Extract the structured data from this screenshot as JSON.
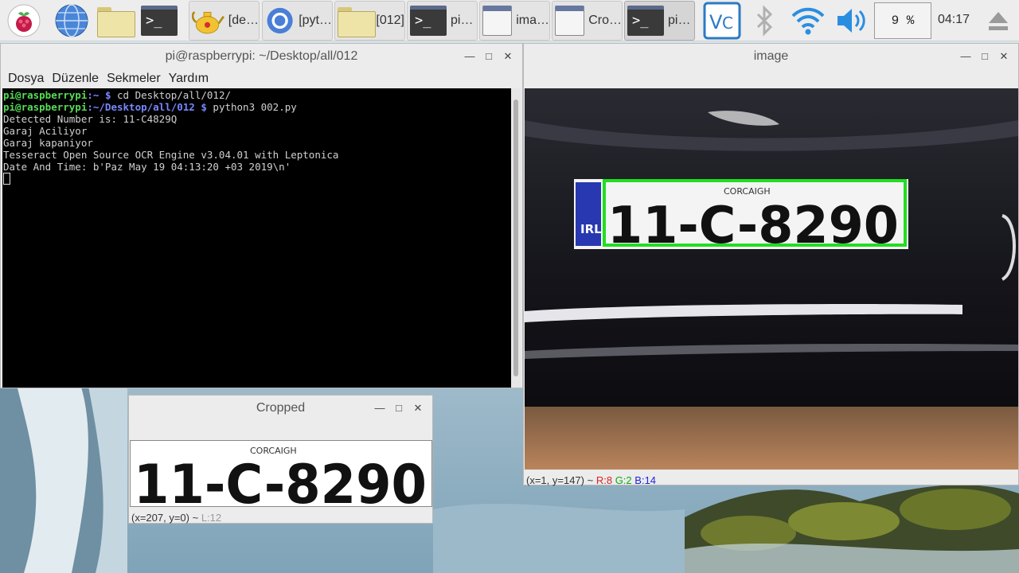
{
  "panel": {
    "tasks": [
      {
        "label": "[de…"
      },
      {
        "label": "[pyt…"
      },
      {
        "label": "[012]"
      },
      {
        "label": "pi…"
      },
      {
        "label": "ima…"
      },
      {
        "label": "Cro…"
      },
      {
        "label": "pi…"
      }
    ],
    "cpu_value": "9 %",
    "clock": "04:17"
  },
  "terminal": {
    "title": "pi@raspberrypi: ~/Desktop/all/012",
    "menu": [
      "Dosya",
      "Düzenle",
      "Sekmeler",
      "Yardım"
    ],
    "lines": [
      {
        "user": "pi@raspberrypi",
        "path": ":~",
        "sym": " $",
        "cmd": " cd Desktop/all/012/"
      },
      {
        "user": "pi@raspberrypi",
        "path": ":~/Desktop/all/012",
        "sym": " $",
        "cmd": " python3 002.py"
      }
    ],
    "output": [
      "Detected Number is: 11-C4829Q",
      "Garaj Aciliyor",
      "Garaj kapaniyor",
      "Tesseract Open Source OCR Engine v3.04.01 with Leptonica",
      "Date And Time: b'Paz May 19 04:13:20 +03 2019\\n'"
    ]
  },
  "image_window": {
    "title": "image",
    "plate_county": "CORCAIGH",
    "plate_number": "11-C-8290",
    "plate_badge": "IRL",
    "status_coords": "(x=1, y=147) ~",
    "status_r": "R:8",
    "status_g": "G:2",
    "status_b": "B:14"
  },
  "cropped_window": {
    "title": "Cropped",
    "plate_county": "CORCAIGH",
    "plate_number": "11-C-8290",
    "status": "(x=207, y=0) ~",
    "status_l": "L:12"
  },
  "colors": {
    "panel_bg": "#ededed",
    "terminal_bg": "#000000",
    "prompt_user": "#55dd55",
    "prompt_path": "#7788ff",
    "detection_box": "#22dd22"
  }
}
